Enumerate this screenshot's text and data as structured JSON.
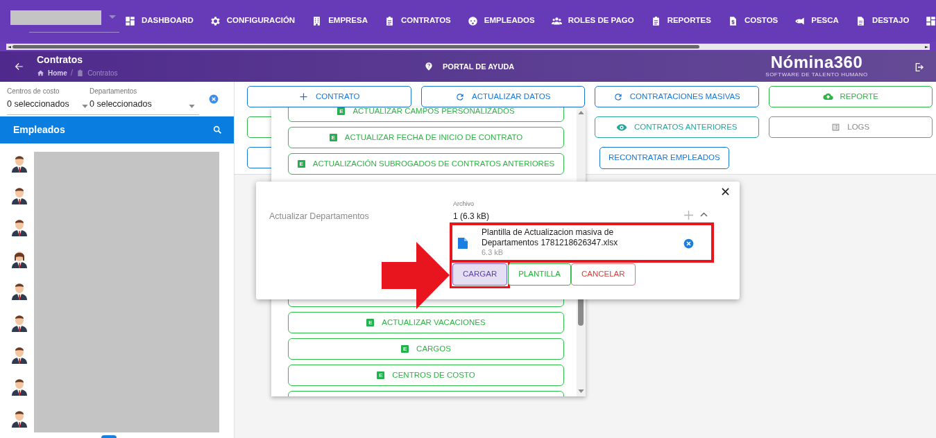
{
  "nav": {
    "items": [
      {
        "label": "DASHBOARD"
      },
      {
        "label": "CONFIGURACIÓN"
      },
      {
        "label": "EMPRESA"
      },
      {
        "label": "CONTRATOS"
      },
      {
        "label": "EMPLEADOS"
      },
      {
        "label": "ROLES DE PAGO"
      },
      {
        "label": "REPORTES"
      },
      {
        "label": "COSTOS"
      },
      {
        "label": "PESCA"
      },
      {
        "label": "DESTAJO"
      }
    ]
  },
  "subheader": {
    "title": "Contratos",
    "breadcrumb": [
      "Home",
      "Contratos"
    ],
    "breadcrumb_separator": "/",
    "help": "PORTAL DE AYUDA",
    "logo": "Nómina360",
    "logo_tagline": "SOFTWARE DE TALENTO HUMANO"
  },
  "filters": [
    {
      "label": "Centros de costo",
      "value": "0 seleccionados"
    },
    {
      "label": "Departamentos",
      "value": "0 seleccionados"
    }
  ],
  "employees": {
    "title": "Empleados",
    "rows": [
      {
        "kind": "male"
      },
      {
        "kind": "male"
      },
      {
        "kind": "male"
      },
      {
        "kind": "female"
      },
      {
        "kind": "male"
      },
      {
        "kind": "male"
      },
      {
        "kind": "male"
      },
      {
        "kind": "male"
      },
      {
        "kind": "male"
      }
    ]
  },
  "toolbar": [
    {
      "label": "CONTRATO"
    },
    {
      "label": "ACTUALIZAR DATOS"
    },
    {
      "label": "CONTRATACIONES MASIVAS"
    },
    {
      "label": "REPORTE"
    },
    {
      "label": "CONTRATOS ANTERIORES"
    },
    {
      "label": "LOGS"
    },
    {
      "label": "RECONTRATAR EMPLEADOS"
    }
  ],
  "dropdown": {
    "items": [
      {
        "badge": "E",
        "label": "ACTUALIZAR CAMPOS PERSONALIZADOS"
      },
      {
        "badge": "E",
        "label": "ACTUALIZAR FECHA DE INICIO DE CONTRATO"
      },
      {
        "badge": "E",
        "label": "ACTUALIZACIÓN SUBROGADOS DE CONTRATOS ANTERIORES"
      }
    ],
    "items_below": [
      {
        "badge": "E",
        "label": "ACTUALIZAR VACACIONES"
      },
      {
        "badge": "E",
        "label": "CARGOS"
      },
      {
        "badge": "E",
        "label": "CENTROS DE COSTO"
      }
    ]
  },
  "dialog": {
    "title": "Actualizar Departamentos",
    "file_label": "Archivo",
    "file_summary": "1 (6.3 kB)",
    "file": {
      "name": "Plantilla de Actualizacion masiva de Departamentos 1781218626347.xlsx",
      "size": "6.3 kB",
      "highlighted": true
    },
    "buttons": [
      {
        "label": "CARGAR",
        "highlighted": true
      },
      {
        "label": "PLANTILLA",
        "highlighted": false
      },
      {
        "label": "CANCELAR",
        "highlighted": false
      }
    ]
  }
}
